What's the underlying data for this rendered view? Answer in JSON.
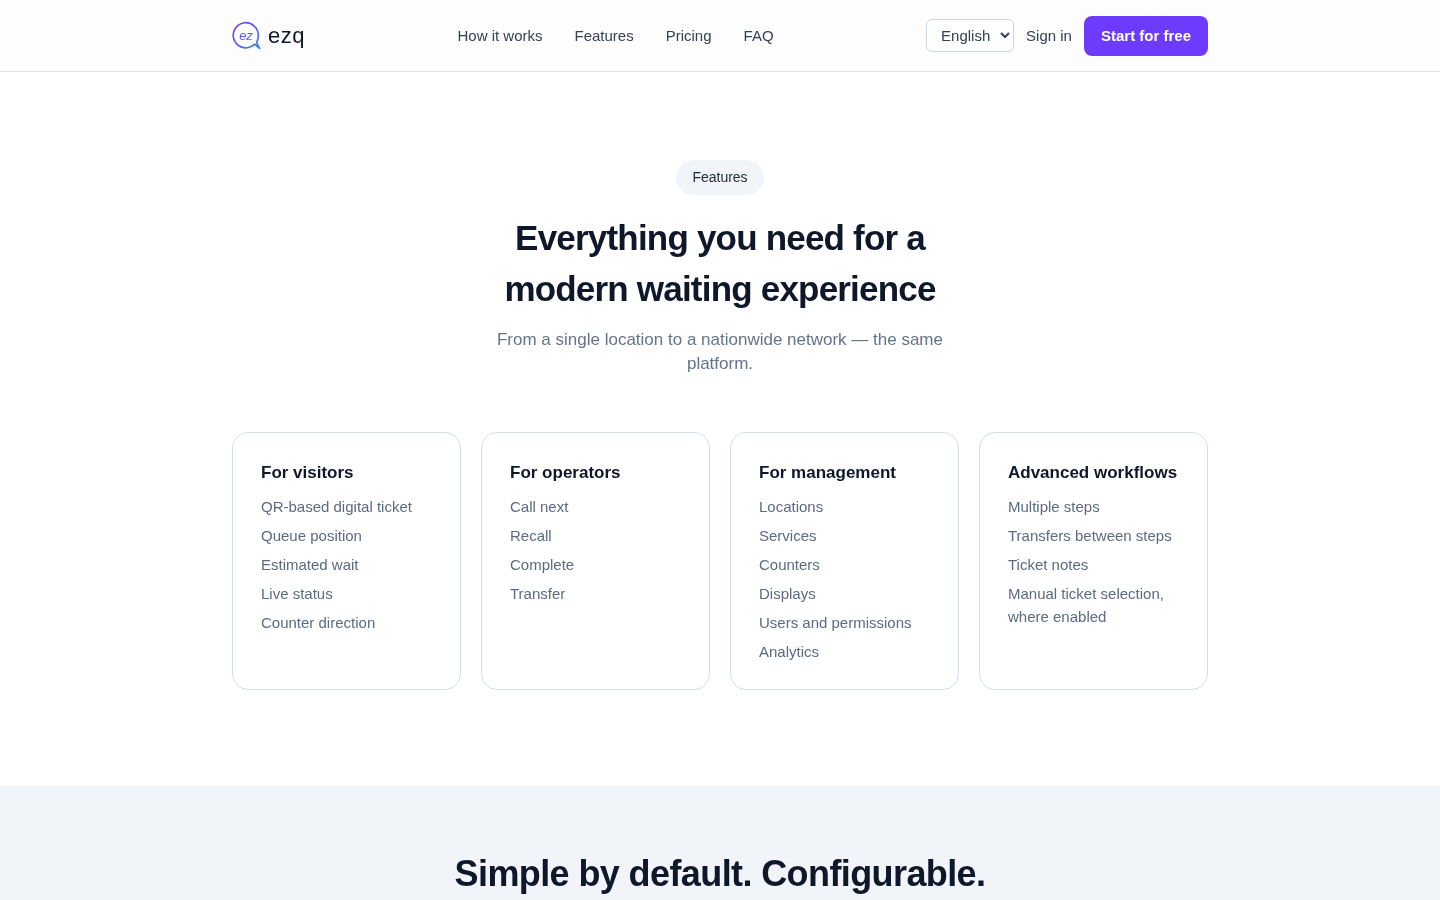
{
  "header": {
    "logo": {
      "mark": "ez",
      "name": "ezq"
    },
    "nav": [
      "How it works",
      "Features",
      "Pricing",
      "FAQ"
    ],
    "language": {
      "value": "English"
    },
    "sign_in": "Sign in",
    "cta": "Start for free"
  },
  "features": {
    "badge": "Features",
    "title": "Everything you need for a modern waiting experience",
    "subtitle": "From a single location to a nationwide network — the same platform.",
    "cards": [
      {
        "title": "For visitors",
        "items": [
          "QR-based digital ticket",
          "Queue position",
          "Estimated wait",
          "Live status",
          "Counter direction"
        ]
      },
      {
        "title": "For operators",
        "items": [
          "Call next",
          "Recall",
          "Complete",
          "Transfer"
        ]
      },
      {
        "title": "For management",
        "items": [
          "Locations",
          "Services",
          "Counters",
          "Displays",
          "Users and permissions",
          "Analytics"
        ]
      },
      {
        "title": "Advanced workflows",
        "items": [
          "Multiple steps",
          "Transfers between steps",
          "Ticket notes",
          "Manual ticket selection, where enabled"
        ]
      }
    ]
  },
  "next_section": {
    "title": "Simple by default. Configurable."
  }
}
